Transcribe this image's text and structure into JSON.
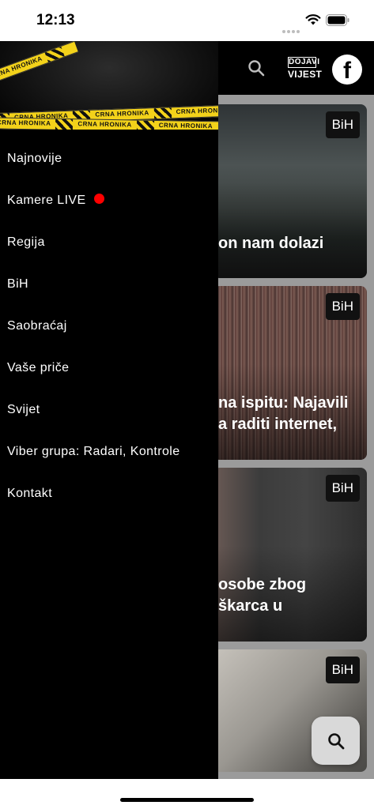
{
  "status_bar": {
    "time": "12:13"
  },
  "header": {
    "search_icon": "search-icon",
    "dojavi_line1": "DOJAVI",
    "dojavi_line2": "VIJEST",
    "facebook_icon": "facebook-icon",
    "facebook_glyph": "f"
  },
  "drawer": {
    "banner_tape_text": "CRNA HRONIKA",
    "items": [
      {
        "label": "Najnovije"
      },
      {
        "label": "Kamere LIVE",
        "live": true
      },
      {
        "label": "Regija"
      },
      {
        "label": "BiH"
      },
      {
        "label": "Saobraćaj"
      },
      {
        "label": "Vaše priče"
      },
      {
        "label": "Svijet"
      },
      {
        "label": "Viber grupa: Radari, Kontrole"
      },
      {
        "label": "Kontakt"
      }
    ]
  },
  "articles": [
    {
      "badge": "BiH",
      "title": "on nam dolazi"
    },
    {
      "badge": "BiH",
      "title": "na ispitu: Najavili\na raditi internet,"
    },
    {
      "badge": "BiH",
      "title": "osobe zbog\nškarca u"
    },
    {
      "badge": "BiH",
      "title": ""
    }
  ],
  "colors": {
    "drawer_bg": "#000000",
    "live_dot": "#ff0000",
    "tape": "#f3d21a",
    "scrim": "#9b9b9b"
  }
}
